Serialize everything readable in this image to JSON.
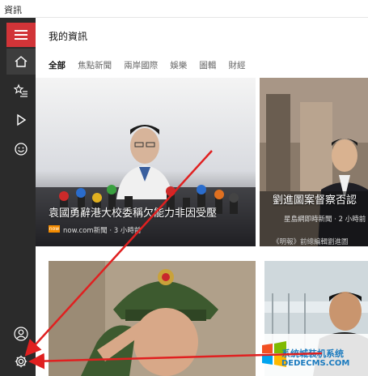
{
  "window": {
    "title": "資訊"
  },
  "sidebar": {
    "items": [
      {
        "name": "home",
        "icon": "home-icon"
      },
      {
        "name": "favorites",
        "icon": "star-list-icon"
      },
      {
        "name": "video",
        "icon": "play-icon"
      },
      {
        "name": "interests",
        "icon": "smiley-icon"
      }
    ],
    "bottom": [
      {
        "name": "account",
        "icon": "person-icon"
      },
      {
        "name": "settings",
        "icon": "gear-icon"
      }
    ]
  },
  "main": {
    "title": "我的資訊",
    "tabs": [
      "全部",
      "焦點新聞",
      "兩岸國際",
      "娛樂",
      "圖輯",
      "財經"
    ],
    "active_tab": 0
  },
  "cards": [
    {
      "headline": "袁國勇辭港大校委稱欠能力非因受壓",
      "source": "now.com新聞 · 3 小時前",
      "logo": "now"
    },
    {
      "headline": "劉進圖案督察否認",
      "source": "星島網即時新聞 · 2 小時前",
      "caption": "《明報》前總編輯劉進圖"
    },
    {
      "headline": ""
    },
    {
      "headline": ""
    }
  ],
  "watermark": {
    "cn": "系统城装机系统",
    "domain": "DEDECMS.COM"
  },
  "colors": {
    "accent": "#d13438",
    "sidebar": "#2b2b2b",
    "arrow": "#e02020"
  }
}
